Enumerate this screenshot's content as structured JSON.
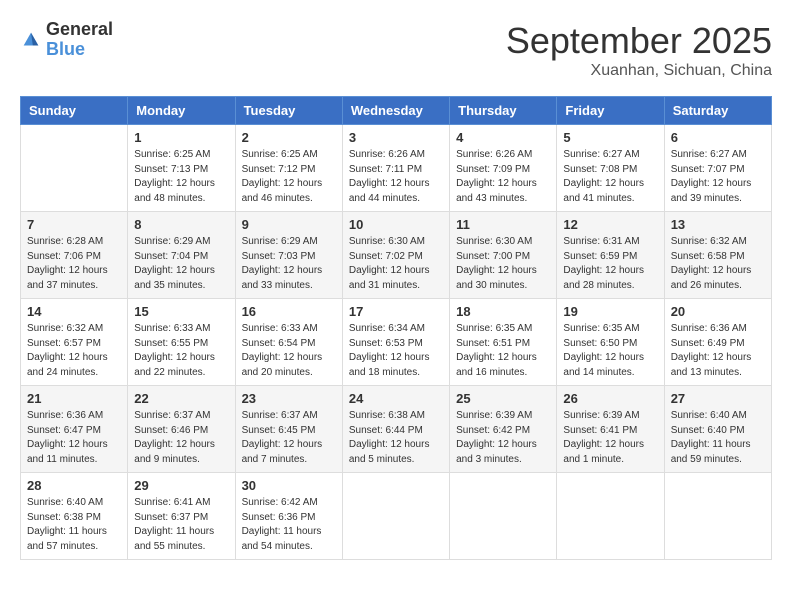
{
  "logo": {
    "general": "General",
    "blue": "Blue"
  },
  "header": {
    "month": "September 2025",
    "location": "Xuanhan, Sichuan, China"
  },
  "weekdays": [
    "Sunday",
    "Monday",
    "Tuesday",
    "Wednesday",
    "Thursday",
    "Friday",
    "Saturday"
  ],
  "weeks": [
    [
      {
        "day": "",
        "info": ""
      },
      {
        "day": "1",
        "info": "Sunrise: 6:25 AM\nSunset: 7:13 PM\nDaylight: 12 hours\nand 48 minutes."
      },
      {
        "day": "2",
        "info": "Sunrise: 6:25 AM\nSunset: 7:12 PM\nDaylight: 12 hours\nand 46 minutes."
      },
      {
        "day": "3",
        "info": "Sunrise: 6:26 AM\nSunset: 7:11 PM\nDaylight: 12 hours\nand 44 minutes."
      },
      {
        "day": "4",
        "info": "Sunrise: 6:26 AM\nSunset: 7:09 PM\nDaylight: 12 hours\nand 43 minutes."
      },
      {
        "day": "5",
        "info": "Sunrise: 6:27 AM\nSunset: 7:08 PM\nDaylight: 12 hours\nand 41 minutes."
      },
      {
        "day": "6",
        "info": "Sunrise: 6:27 AM\nSunset: 7:07 PM\nDaylight: 12 hours\nand 39 minutes."
      }
    ],
    [
      {
        "day": "7",
        "info": "Sunrise: 6:28 AM\nSunset: 7:06 PM\nDaylight: 12 hours\nand 37 minutes."
      },
      {
        "day": "8",
        "info": "Sunrise: 6:29 AM\nSunset: 7:04 PM\nDaylight: 12 hours\nand 35 minutes."
      },
      {
        "day": "9",
        "info": "Sunrise: 6:29 AM\nSunset: 7:03 PM\nDaylight: 12 hours\nand 33 minutes."
      },
      {
        "day": "10",
        "info": "Sunrise: 6:30 AM\nSunset: 7:02 PM\nDaylight: 12 hours\nand 31 minutes."
      },
      {
        "day": "11",
        "info": "Sunrise: 6:30 AM\nSunset: 7:00 PM\nDaylight: 12 hours\nand 30 minutes."
      },
      {
        "day": "12",
        "info": "Sunrise: 6:31 AM\nSunset: 6:59 PM\nDaylight: 12 hours\nand 28 minutes."
      },
      {
        "day": "13",
        "info": "Sunrise: 6:32 AM\nSunset: 6:58 PM\nDaylight: 12 hours\nand 26 minutes."
      }
    ],
    [
      {
        "day": "14",
        "info": "Sunrise: 6:32 AM\nSunset: 6:57 PM\nDaylight: 12 hours\nand 24 minutes."
      },
      {
        "day": "15",
        "info": "Sunrise: 6:33 AM\nSunset: 6:55 PM\nDaylight: 12 hours\nand 22 minutes."
      },
      {
        "day": "16",
        "info": "Sunrise: 6:33 AM\nSunset: 6:54 PM\nDaylight: 12 hours\nand 20 minutes."
      },
      {
        "day": "17",
        "info": "Sunrise: 6:34 AM\nSunset: 6:53 PM\nDaylight: 12 hours\nand 18 minutes."
      },
      {
        "day": "18",
        "info": "Sunrise: 6:35 AM\nSunset: 6:51 PM\nDaylight: 12 hours\nand 16 minutes."
      },
      {
        "day": "19",
        "info": "Sunrise: 6:35 AM\nSunset: 6:50 PM\nDaylight: 12 hours\nand 14 minutes."
      },
      {
        "day": "20",
        "info": "Sunrise: 6:36 AM\nSunset: 6:49 PM\nDaylight: 12 hours\nand 13 minutes."
      }
    ],
    [
      {
        "day": "21",
        "info": "Sunrise: 6:36 AM\nSunset: 6:47 PM\nDaylight: 12 hours\nand 11 minutes."
      },
      {
        "day": "22",
        "info": "Sunrise: 6:37 AM\nSunset: 6:46 PM\nDaylight: 12 hours\nand 9 minutes."
      },
      {
        "day": "23",
        "info": "Sunrise: 6:37 AM\nSunset: 6:45 PM\nDaylight: 12 hours\nand 7 minutes."
      },
      {
        "day": "24",
        "info": "Sunrise: 6:38 AM\nSunset: 6:44 PM\nDaylight: 12 hours\nand 5 minutes."
      },
      {
        "day": "25",
        "info": "Sunrise: 6:39 AM\nSunset: 6:42 PM\nDaylight: 12 hours\nand 3 minutes."
      },
      {
        "day": "26",
        "info": "Sunrise: 6:39 AM\nSunset: 6:41 PM\nDaylight: 12 hours\nand 1 minute."
      },
      {
        "day": "27",
        "info": "Sunrise: 6:40 AM\nSunset: 6:40 PM\nDaylight: 11 hours\nand 59 minutes."
      }
    ],
    [
      {
        "day": "28",
        "info": "Sunrise: 6:40 AM\nSunset: 6:38 PM\nDaylight: 11 hours\nand 57 minutes."
      },
      {
        "day": "29",
        "info": "Sunrise: 6:41 AM\nSunset: 6:37 PM\nDaylight: 11 hours\nand 55 minutes."
      },
      {
        "day": "30",
        "info": "Sunrise: 6:42 AM\nSunset: 6:36 PM\nDaylight: 11 hours\nand 54 minutes."
      },
      {
        "day": "",
        "info": ""
      },
      {
        "day": "",
        "info": ""
      },
      {
        "day": "",
        "info": ""
      },
      {
        "day": "",
        "info": ""
      }
    ]
  ]
}
